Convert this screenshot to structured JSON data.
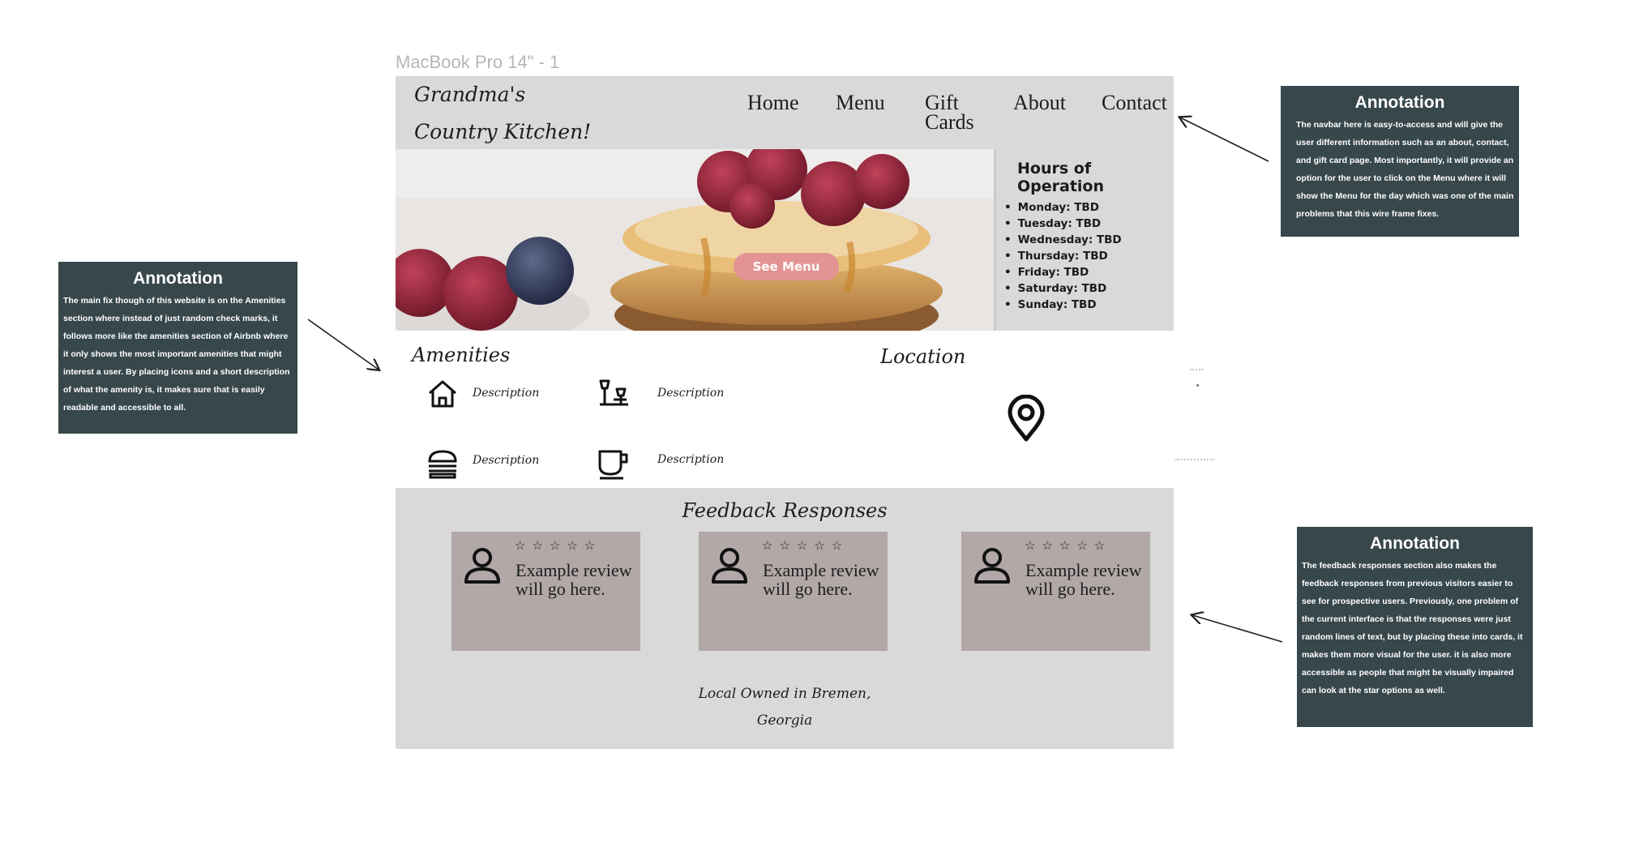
{
  "frame_label": "MacBook Pro 14\" - 1",
  "brand": {
    "line1": "Grandma's",
    "line2": "Country Kitchen!"
  },
  "nav": {
    "home": "Home",
    "menu": "Menu",
    "gift_line1": "Gift",
    "gift_line2": "Cards",
    "about": "About",
    "contact": "Contact"
  },
  "hero": {
    "see_menu": "See Menu"
  },
  "hours": {
    "title": "Hours of Operation",
    "days": [
      "Monday: TBD",
      "Tuesday: TBD",
      "Wednesday: TBD",
      "Thursday: TBD",
      "Friday: TBD",
      "Saturday: TBD",
      "Sunday: TBD"
    ]
  },
  "amenities": {
    "title": "Amenities",
    "items": [
      {
        "icon": "home-icon",
        "label": "Description"
      },
      {
        "icon": "lamp-icon",
        "label": "Description"
      },
      {
        "icon": "burger-icon",
        "label": "Description"
      },
      {
        "icon": "cup-icon",
        "label": "Description"
      }
    ]
  },
  "location": {
    "title": "Location",
    "icon": "map-pin-icon"
  },
  "feedback": {
    "title": "Feedback Responses",
    "cards": [
      {
        "stars": "☆☆☆☆☆",
        "review": "Example review will go here."
      },
      {
        "stars": "☆☆☆☆☆",
        "review": "Example review will go here."
      },
      {
        "stars": "☆☆☆☆☆",
        "review": "Example review will go here."
      }
    ],
    "footer_line1": "Local Owned in Bremen,",
    "footer_line2": "Georgia"
  },
  "annotations": [
    {
      "title": "Annotation",
      "body": "The navbar here is easy-to-access and will give the user different information such as an about, contact, and gift card page. Most importantly, it will provide an option for the user to click on the Menu where it will show the Menu for the day which was one of the main problems that this wire frame fixes."
    },
    {
      "title": "Annotation",
      "body": "The main fix though of this website is on the Amenities section where instead of just random check marks, it follows more like the amenities section of Airbnb where it only shows the most important amenities that might interest a user. By placing icons and a short description of what the amenity is, it makes sure that is easily readable and accessible to all."
    },
    {
      "title": "Annotation",
      "body": "The feedback responses section also makes the feedback responses from previous visitors easier to see for prospective users. Previously, one problem of the current interface is that the responses were just random lines of text, but by placing these into cards, it makes them more visual for the user. it is also more accessible as people that might be visually impaired can look at the star options as well."
    }
  ],
  "colors": {
    "panel_gray": "#d9d9d9",
    "card_mauve": "#b1a8a7",
    "button_pink": "#e39393",
    "annotation_slate": "#37474b"
  }
}
